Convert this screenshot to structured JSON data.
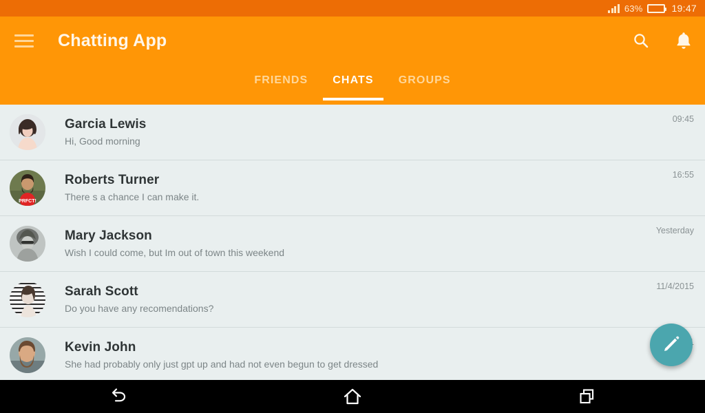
{
  "status_bar": {
    "signal_icon": "signal-bars-icon",
    "battery_percent": "63%",
    "battery_icon": "battery-icon",
    "clock": "19:47"
  },
  "app_bar": {
    "menu_icon": "hamburger-menu-icon",
    "title": "Chatting App",
    "search_icon": "search-icon",
    "notification_icon": "bell-icon"
  },
  "tabs": [
    {
      "label": "FRIENDS",
      "active": false
    },
    {
      "label": "CHATS",
      "active": true
    },
    {
      "label": "GROUPS",
      "active": false
    }
  ],
  "chats": [
    {
      "name": "Garcia Lewis",
      "preview": "Hi, Good morning",
      "time": "09:45"
    },
    {
      "name": "Roberts Turner",
      "preview": "There s a chance I can make it.",
      "time": "16:55"
    },
    {
      "name": "Mary Jackson",
      "preview": "Wish I could come, but Im out of town this weekend",
      "time": "Yesterday"
    },
    {
      "name": "Sarah Scott",
      "preview": "Do you have any recomendations?",
      "time": "11/4/2015"
    },
    {
      "name": "Kevin John",
      "preview": "She had probably only just gpt up and had not even begun to get dressed",
      "time": "1"
    }
  ],
  "fab": {
    "icon": "compose-pencil-icon"
  },
  "nav_bar": [
    {
      "icon": "back-icon"
    },
    {
      "icon": "home-icon"
    },
    {
      "icon": "recents-icon"
    }
  ],
  "colors": {
    "status_bar": "#ED6D05",
    "app_bar": "#FF9606",
    "list_background": "#E9EFEF",
    "fab": "#4BA6AE",
    "nav_bar": "#000000",
    "primary_text": "#2F3536",
    "secondary_text": "#7C8587"
  }
}
